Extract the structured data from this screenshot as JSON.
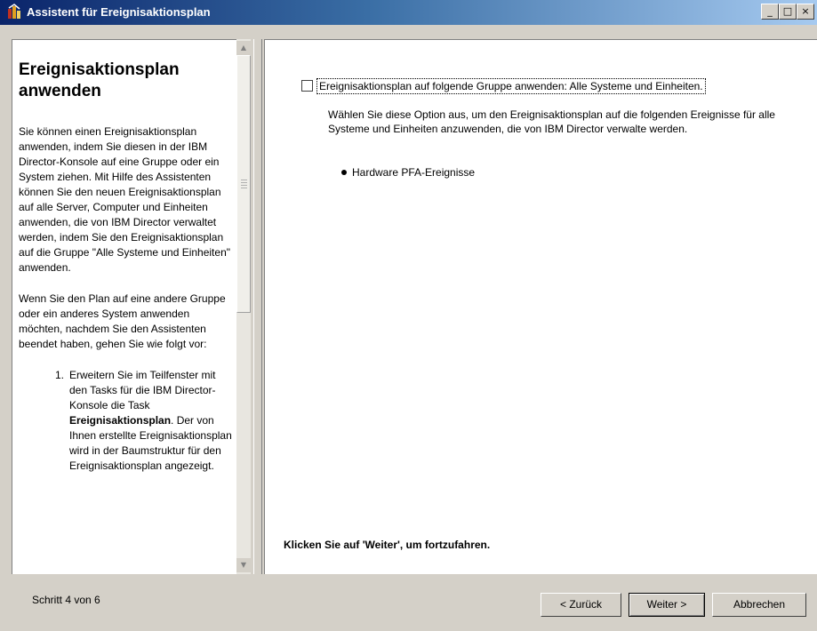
{
  "window": {
    "title": "Assistent für Ereignisaktionsplan",
    "controls": {
      "minimize": "_",
      "maximize": "□",
      "close": "×"
    }
  },
  "left_pane": {
    "heading": "Ereignisaktionsplan anwenden",
    "paragraph1": "Sie können einen Ereignisaktionsplan anwenden, indem Sie diesen in der IBM Director-Konsole auf eine Gruppe oder ein System ziehen. Mit Hilfe des Assistenten können Sie den neuen Ereignisaktionsplan auf alle Server, Computer und Einheiten anwenden, die von IBM Director verwaltet werden, indem Sie den Ereignisaktionsplan auf die Gruppe \"Alle Systeme und Einheiten\" anwenden.",
    "paragraph2": "Wenn Sie den Plan auf eine andere Gruppe oder ein anderes System anwenden möchten, nachdem Sie den Assistenten beendet haben, gehen Sie wie folgt vor:",
    "steps": [
      {
        "number": "1.",
        "text_before": "Erweitern Sie im Teilfenster mit den Tasks für die IBM Director-Konsole die Task ",
        "bold": "Ereignisaktionsplan",
        "text_after": ". Der von Ihnen erstellte Ereignisaktionsplan wird in der Baumstruktur für den Ereignisaktionsplan angezeigt."
      }
    ]
  },
  "right_pane": {
    "checkbox_label": "Ereignisaktionsplan auf folgende Gruppe anwenden: Alle Systeme und Einheiten.",
    "checkbox_checked": false,
    "description": "Wählen Sie diese Option aus, um den Ereignisaktionsplan auf die folgenden Ereignisse für alle Systeme und Einheiten anzuwenden, die von IBM Director verwalte werden.",
    "events": [
      "Hardware PFA-Ereignisse"
    ],
    "continue_hint": "Klicken Sie auf 'Weiter', um fortzufahren."
  },
  "footer": {
    "step_text": "Schritt 4 von 6",
    "back_label": "< Zurück",
    "next_label": "Weiter >",
    "cancel_label": "Abbrechen"
  },
  "colors": {
    "titlebar_start": "#0a246a",
    "titlebar_end": "#a6caf0",
    "dialog_background": "#d4d0c8",
    "pane_background": "#ffffff"
  }
}
